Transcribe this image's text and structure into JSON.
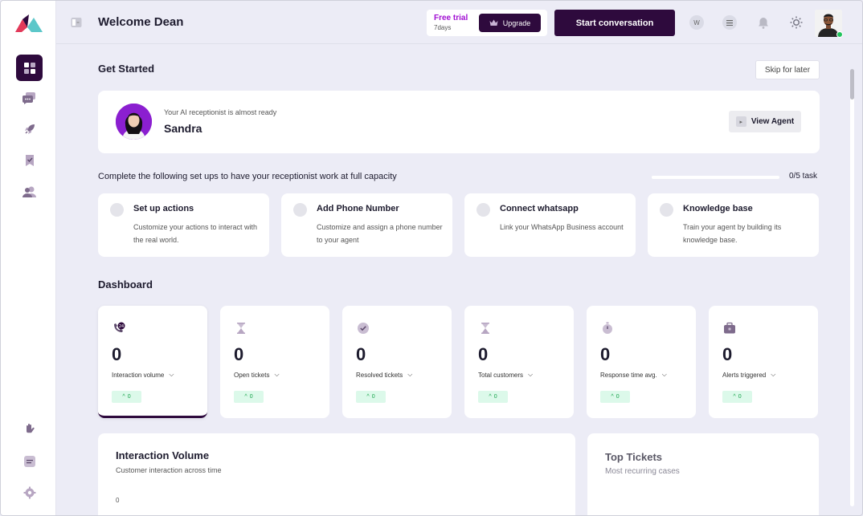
{
  "header": {
    "welcome": "Welcome Dean",
    "trial_title": "Free trial",
    "trial_days": "7days",
    "upgrade_label": "Upgrade",
    "start_conversation_label": "Start conversation",
    "w_icon_label": "W"
  },
  "get_started": {
    "title": "Get Started",
    "skip_label": "Skip for later",
    "agent_sub": "Your AI receptionist is almost ready",
    "agent_name": "Sandra",
    "view_agent_label": "View Agent",
    "setup_text": "Complete the following set ups to have your receptionist work at full capacity",
    "progress_text": "0/5 task",
    "progress_fraction": 0,
    "steps": [
      {
        "title": "Set up actions",
        "desc": "Customize your actions to interact with the real world."
      },
      {
        "title": "Add Phone Number",
        "desc": "Customize and assign a phone number to your agent"
      },
      {
        "title": "Connect whatsapp",
        "desc": "Link your WhatsApp Business account"
      },
      {
        "title": "Knowledge base",
        "desc": "Train your agent by building its knowledge base."
      }
    ]
  },
  "dashboard": {
    "title": "Dashboard",
    "stats": [
      {
        "value": "0",
        "label": "Interaction volume",
        "badge": "0",
        "icon": "24h-phone-icon"
      },
      {
        "value": "0",
        "label": "Open tickets",
        "badge": "0",
        "icon": "hourglass-icon"
      },
      {
        "value": "0",
        "label": "Resolved tickets",
        "badge": "0",
        "icon": "check-circle-icon"
      },
      {
        "value": "0",
        "label": "Total customers",
        "badge": "0",
        "icon": "hourglass-icon"
      },
      {
        "value": "0",
        "label": "Response time avg.",
        "badge": "0",
        "icon": "stopwatch-icon"
      },
      {
        "value": "0",
        "label": "Alerts triggered",
        "badge": "0",
        "icon": "toolbox-icon"
      }
    ]
  },
  "interaction_volume": {
    "title": "Interaction Volume",
    "subtitle": "Customer interaction across time",
    "tick": "0"
  },
  "top_tickets": {
    "title": "Top Tickets",
    "subtitle": "Most recurring cases"
  },
  "colors": {
    "brand": "#2e0a3d",
    "trial": "#a10fd3",
    "badge_bg": "#dcf9ea",
    "badge_text": "#17a34a",
    "online": "#21c45d"
  }
}
